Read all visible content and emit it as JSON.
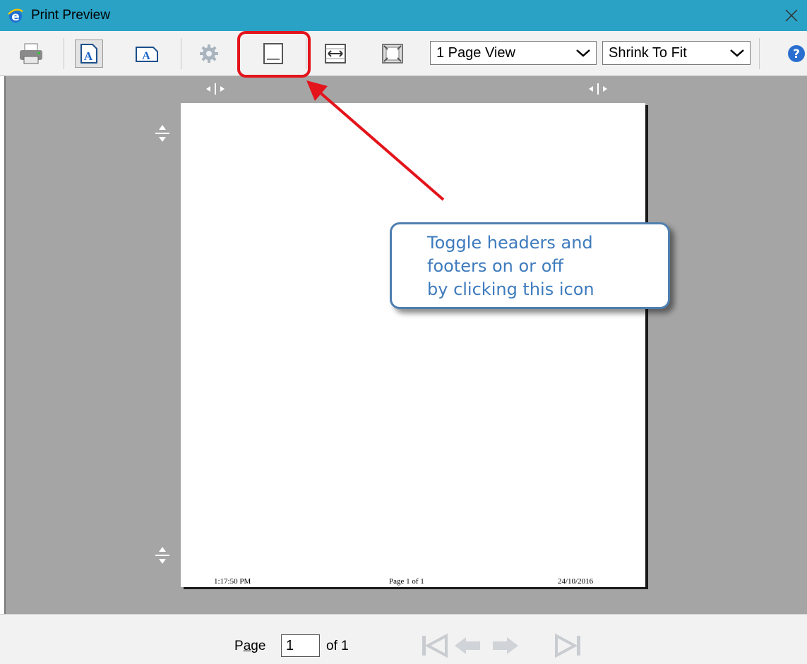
{
  "window": {
    "title": "Print Preview",
    "app_icon": "internet-explorer-icon",
    "close_icon": "close-icon"
  },
  "toolbar": {
    "buttons": [
      {
        "name": "print-button",
        "icon": "printer-icon"
      },
      {
        "name": "portrait-button",
        "icon": "portrait-page-icon",
        "pressed": true
      },
      {
        "name": "landscape-button",
        "icon": "landscape-page-icon"
      },
      {
        "name": "page-setup-button",
        "icon": "gear-icon"
      },
      {
        "name": "headers-footers-toggle-button",
        "icon": "header-footer-icon"
      },
      {
        "name": "full-width-button",
        "icon": "full-width-icon"
      },
      {
        "name": "full-page-button",
        "icon": "full-page-icon"
      }
    ],
    "view_select": "1 Page View",
    "scale_select": "Shrink To Fit",
    "help_icon": "help-icon"
  },
  "page": {
    "footer_left": "1:17:50 PM",
    "footer_center": "Page 1 of 1",
    "footer_right": "24/10/2016"
  },
  "callout": {
    "text": "Toggle headers and\nfooters on or off\nby clicking this icon"
  },
  "pager": {
    "page_label_prefix": "P",
    "page_label_underlined": "a",
    "page_label_suffix": "ge",
    "current_page": "1",
    "of_label": "of 1"
  },
  "colors": {
    "titlebar": "#2aa2c6",
    "highlight": "#e3141b",
    "callout_border": "#4e7fb0",
    "callout_text": "#3e7bbd",
    "preview_background": "#a5a5a5"
  }
}
